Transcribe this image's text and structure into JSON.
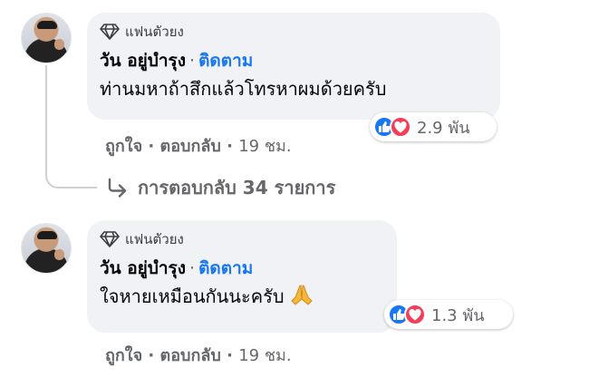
{
  "comments": [
    {
      "badge": "แฟนตัวยง",
      "author": "วัน อยู่บำรุง",
      "separator": "·",
      "follow": "ติดตาม",
      "text": "ท่านมหาถ้าสึกแล้วโทรหาผมด้วยครับ",
      "reaction_count": "2.9 พัน",
      "like_label": "ถูกใจ",
      "reply_label": "ตอบกลับ",
      "time": "19 ชม."
    },
    {
      "badge": "แฟนตัวยง",
      "author": "วัน อยู่บำรุง",
      "separator": "·",
      "follow": "ติดตาม",
      "text": "ใจหายเหมือนกันนะครับ",
      "reaction_count": "1.3 พัน",
      "like_label": "ถูกใจ",
      "reply_label": "ตอบกลับ",
      "time": "19 ชม."
    }
  ],
  "replies_link": "การตอบกลับ 34 รายการ",
  "colors": {
    "bubble": "#f0f2f5",
    "link": "#1877f2",
    "secondary": "#65676b"
  },
  "icons": [
    "diamond-icon",
    "like-reaction-icon",
    "love-reaction-icon",
    "reply-arrow-icon",
    "pray-emoji-icon"
  ]
}
